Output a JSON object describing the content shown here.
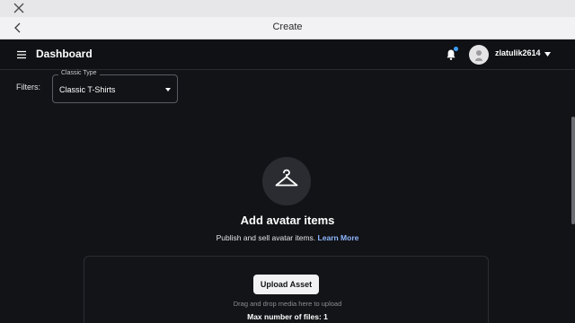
{
  "window": {
    "close_icon": "close-icon"
  },
  "navbar": {
    "title": "Create",
    "back_icon": "chevron-left-icon"
  },
  "appbar": {
    "menu_icon": "hamburger-menu-icon",
    "brand": "Dashboard",
    "notification_icon": "bell-icon",
    "notification_dot_color": "#3aa0ff",
    "username": "zlatulik2614",
    "dropdown_icon": "caret-down-icon"
  },
  "filters": {
    "label": "Filters:",
    "select": {
      "legend": "Classic Type",
      "value": "Classic T-Shirts"
    }
  },
  "empty_state": {
    "icon": "hanger-icon",
    "title": "Add avatar items",
    "description": "Publish and sell avatar items.",
    "link": "Learn More"
  },
  "upload": {
    "button": "Upload Asset",
    "hint": "Drag and drop media here to upload",
    "max_files": "Max number of files: 1"
  },
  "colors": {
    "background": "#121317",
    "link": "#8fb7ff",
    "button_bg": "#f2f2f4"
  }
}
